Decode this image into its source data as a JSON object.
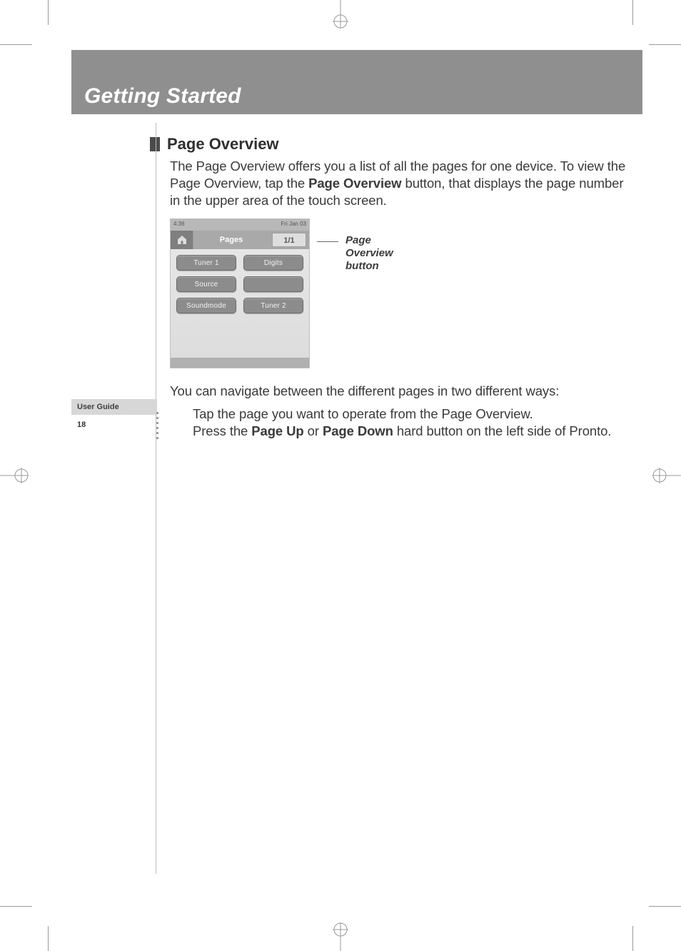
{
  "chapter_title": "Getting Started",
  "section": {
    "heading": "Page Overview",
    "intro_pre": "The Page Overview offers you a list of all the pages for one device. To view the Page Overview, tap the ",
    "intro_bold": "Page Overview",
    "intro_post": " button, that displays the page number in the upper area of the touch screen."
  },
  "device": {
    "top_left": "4:36",
    "top_center": "",
    "top_right": "Fri Jan 03",
    "tab_label": "Pages",
    "page_indicator": "1/1",
    "buttons": [
      "Tuner 1",
      "Digits",
      "Source",
      "",
      "Soundmode",
      "Tuner 2"
    ]
  },
  "callout": {
    "line1": "Page",
    "line2": "Overview",
    "line3": "button"
  },
  "nav_intro": "You can navigate between the different pages in two different ways:",
  "nav_items": {
    "a": "Tap the page you want to operate from the Page Overview.",
    "b_pre": "Press the ",
    "b_b1": "Page Up",
    "b_mid": " or ",
    "b_b2": "Page Down",
    "b_post": " hard button on the left side of Pronto."
  },
  "footer": {
    "label": "User Guide",
    "page_number": "18"
  }
}
